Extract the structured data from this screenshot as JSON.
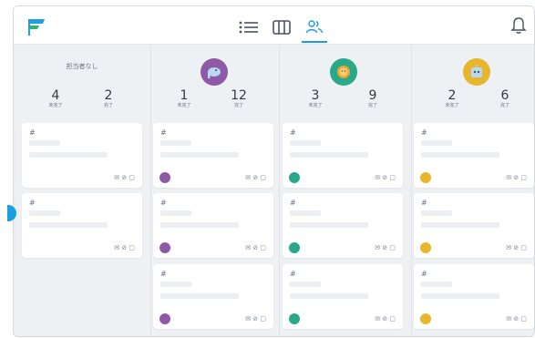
{
  "topbar": {
    "logo_icon": "flag-logo",
    "views": [
      {
        "name": "list-view",
        "icon": "list-icon",
        "active": false
      },
      {
        "name": "board-view",
        "icon": "columns-icon",
        "active": false
      },
      {
        "name": "members-view",
        "icon": "people-icon",
        "active": true
      }
    ],
    "notification_icon": "bell-icon"
  },
  "accent_color": "#1a9fe0",
  "columns": [
    {
      "assignee_label": "担当者なし",
      "avatar_color": "",
      "incomplete_count": "4",
      "incomplete_label": "未完了",
      "complete_count": "2",
      "complete_label": "完了",
      "cards": [
        {
          "hash": "#",
          "icons": "✉ ⊘ ▢"
        },
        {
          "hash": "#",
          "icons": "✉ ⊘ ▢"
        }
      ]
    },
    {
      "assignee_label": "",
      "avatar_color": "#8e5aa8",
      "incomplete_count": "1",
      "incomplete_label": "未完了",
      "complete_count": "12",
      "complete_label": "完了",
      "card_dot_color": "#8e5aa8",
      "cards": [
        {
          "hash": "#",
          "icons": "✉ ⊘ ▢"
        },
        {
          "hash": "#",
          "icons": "✉ ⊘ ▢"
        },
        {
          "hash": "#",
          "icons": "✉ ⊘ ▢"
        }
      ]
    },
    {
      "assignee_label": "",
      "avatar_color": "#2aa88a",
      "incomplete_count": "3",
      "incomplete_label": "未完了",
      "complete_count": "9",
      "complete_label": "完了",
      "card_dot_color": "#2aa88a",
      "cards": [
        {
          "hash": "#",
          "icons": "✉ ⊘ ▢"
        },
        {
          "hash": "#",
          "icons": "✉ ⊘ ▢"
        },
        {
          "hash": "#",
          "icons": "✉ ⊘ ▢"
        }
      ]
    },
    {
      "assignee_label": "",
      "avatar_color": "#e8b62c",
      "incomplete_count": "2",
      "incomplete_label": "未完了",
      "complete_count": "6",
      "complete_label": "完了",
      "card_dot_color": "#e8b62c",
      "cards": [
        {
          "hash": "#",
          "icons": "✉ ⊘ ▢"
        },
        {
          "hash": "#",
          "icons": "✉ ⊘ ▢"
        },
        {
          "hash": "#",
          "icons": "✉ ⊘ ▢"
        }
      ]
    }
  ]
}
